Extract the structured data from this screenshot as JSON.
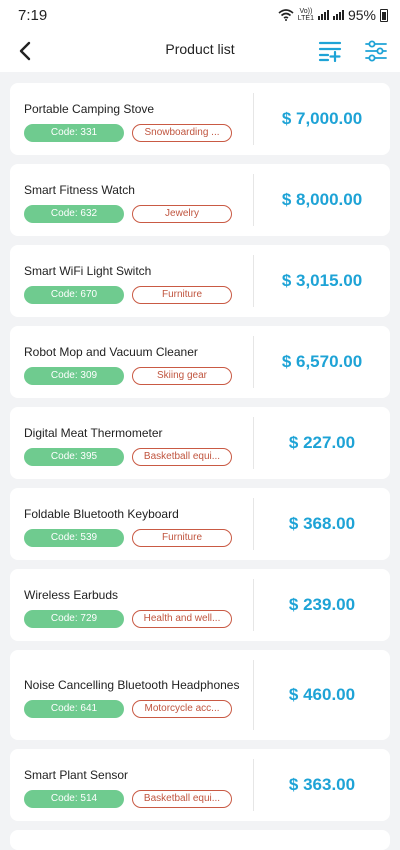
{
  "status_bar": {
    "time": "7:19",
    "network_label_top": "Vo))",
    "network_label_bottom": "LTE1",
    "battery_percent": "95%"
  },
  "app_bar": {
    "title": "Product list",
    "back_icon": "chevron-left-icon",
    "add_icon": "playlist-add-icon",
    "filter_icon": "sliders-icon",
    "accent_color": "#1ea3d6"
  },
  "products": [
    {
      "name": "Portable Camping Stove",
      "code": "Code: 331",
      "category": "Snowboarding ...",
      "price": "$ 7,000.00"
    },
    {
      "name": "Smart Fitness Watch",
      "code": "Code: 632",
      "category": "Jewelry",
      "price": "$ 8,000.00"
    },
    {
      "name": "Smart WiFi Light Switch",
      "code": "Code: 670",
      "category": "Furniture",
      "price": "$ 3,015.00"
    },
    {
      "name": "Robot Mop and Vacuum Cleaner",
      "code": "Code: 309",
      "category": "Skiing gear",
      "price": "$ 6,570.00"
    },
    {
      "name": "Digital Meat Thermometer",
      "code": "Code: 395",
      "category": "Basketball equi...",
      "price": "$ 227.00"
    },
    {
      "name": "Foldable Bluetooth Keyboard",
      "code": "Code: 539",
      "category": "Furniture",
      "price": "$ 368.00"
    },
    {
      "name": "Wireless Earbuds",
      "code": "Code: 729",
      "category": "Health and well...",
      "price": "$ 239.00"
    },
    {
      "name": "Noise Cancelling Bluetooth Headphones",
      "code": "Code: 641",
      "category": "Motorcycle acc...",
      "price": "$ 460.00"
    },
    {
      "name": "Smart Plant Sensor",
      "code": "Code: 514",
      "category": "Basketball equi...",
      "price": "$ 363.00"
    }
  ],
  "colors": {
    "code_tag_bg": "#6fcb8f",
    "category_tag_border": "#c95a44",
    "price_text": "#1ea3d6",
    "background": "#f2f3f5"
  }
}
